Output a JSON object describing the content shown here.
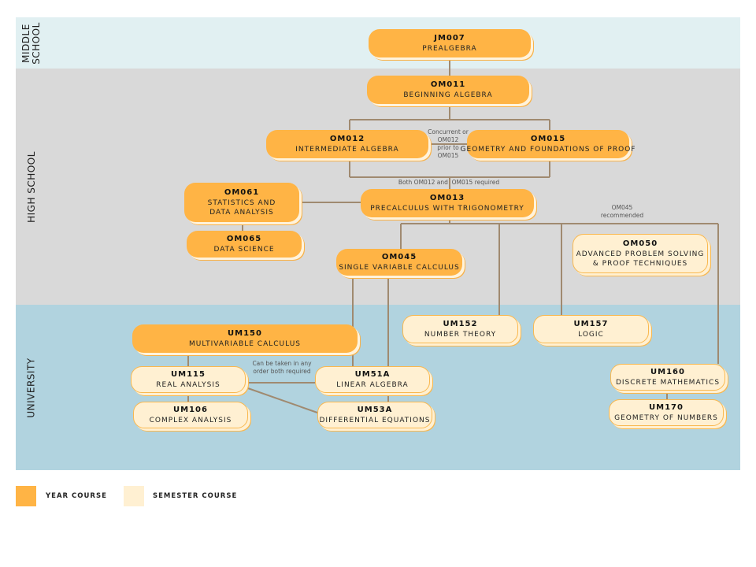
{
  "bands": {
    "middle": "MIDDLE\nSCHOOL",
    "high": "HIGH SCHOOL",
    "university": "UNIVERSITY"
  },
  "colors": {
    "year": "#ffb445",
    "semester": "#fff0d2",
    "middle_bg": "#e1f0f2",
    "high_bg": "#d9d9d9",
    "university_bg": "#b1d3df",
    "line": "#a08a70"
  },
  "courses": {
    "JM007": {
      "code": "JM007",
      "name": "PREALGEBRA",
      "type": "year"
    },
    "OM011": {
      "code": "OM011",
      "name": "BEGINNING ALGEBRA",
      "type": "year"
    },
    "OM012": {
      "code": "OM012",
      "name": "INTERMEDIATE ALGEBRA",
      "type": "year"
    },
    "OM015": {
      "code": "OM015",
      "name": "GEOMETRY AND FOUNDATIONS OF PROOF",
      "type": "year"
    },
    "OM013": {
      "code": "OM013",
      "name": "PRECALCULUS WITH TRIGONOMETRY",
      "type": "year"
    },
    "OM061": {
      "code": "OM061",
      "name": "STATISTICS AND\nDATA ANALYSIS",
      "type": "year"
    },
    "OM065": {
      "code": "OM065",
      "name": "DATA SCIENCE",
      "type": "year"
    },
    "OM045": {
      "code": "OM045",
      "name": "SINGLE VARIABLE CALCULUS",
      "type": "year"
    },
    "OM050": {
      "code": "OM050",
      "name": "ADVANCED PROBLEM SOLVING\n& PROOF TECHNIQUES",
      "type": "semester"
    },
    "UM150": {
      "code": "UM150",
      "name": "MULTIVARIABLE CALCULUS",
      "type": "year"
    },
    "UM152": {
      "code": "UM152",
      "name": "NUMBER THEORY",
      "type": "semester"
    },
    "UM157": {
      "code": "UM157",
      "name": "LOGIC",
      "type": "semester"
    },
    "UM115": {
      "code": "UM115",
      "name": "REAL ANALYSIS",
      "type": "semester"
    },
    "UM106": {
      "code": "UM106",
      "name": "COMPLEX ANALYSIS",
      "type": "semester"
    },
    "UM51A": {
      "code": "UM51A",
      "name": "LINEAR ALGEBRA",
      "type": "semester"
    },
    "UM53A": {
      "code": "UM53A",
      "name": "DIFFERENTIAL EQUATIONS",
      "type": "semester"
    },
    "UM160": {
      "code": "UM160",
      "name": "DISCRETE MATHEMATICS",
      "type": "semester"
    },
    "UM170": {
      "code": "UM170",
      "name": "GEOMETRY OF NUMBERS",
      "type": "semester"
    }
  },
  "edges": [
    [
      "JM007",
      "OM011"
    ],
    [
      "OM011",
      "OM012"
    ],
    [
      "OM011",
      "OM015"
    ],
    [
      "OM012",
      "OM015"
    ],
    [
      "OM012",
      "OM013"
    ],
    [
      "OM015",
      "OM013"
    ],
    [
      "OM013",
      "OM061"
    ],
    [
      "OM061",
      "OM065"
    ],
    [
      "OM013",
      "OM045"
    ],
    [
      "OM013",
      "UM152"
    ],
    [
      "OM013",
      "UM157"
    ],
    [
      "OM013",
      "UM160"
    ],
    [
      "OM045",
      "UM51A"
    ],
    [
      "UM150",
      "UM115"
    ],
    [
      "UM115",
      "UM106"
    ],
    [
      "UM115",
      "UM51A"
    ],
    [
      "UM115",
      "UM53A"
    ],
    [
      "UM51A",
      "UM53A"
    ],
    [
      "UM160",
      "UM170"
    ]
  ],
  "notes": {
    "concurrent": "Concurrent or\nOM012\nprior to\nOM015",
    "both_required": "Both OM012 and  OM015 required",
    "om045_recommended": "OM045\nrecommended",
    "any_order": "Can be taken in any\norder both required"
  },
  "legend": {
    "year": "YEAR COURSE",
    "semester": "SEMESTER COURSE"
  }
}
